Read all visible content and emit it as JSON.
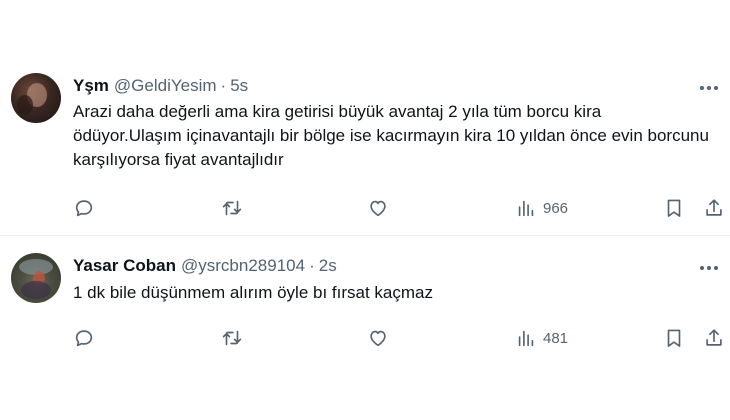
{
  "tweets": [
    {
      "name": "Yşm",
      "handle": "@GeldiYesim",
      "separator": "·",
      "time": "5s",
      "text": "Arazi daha değerli ama kira getirisi büyük avantaj 2 yıla tüm borcu kira ödüyor.Ulaşım içinavantajlı bir bölge ise kacırmayın kira 10 yıldan önce evin borcunu  karşılıyorsa fiyat avantajlıdır",
      "views": "966",
      "icons": [
        "more-icon",
        "reply-icon",
        "retweet-icon",
        "like-icon",
        "views-icon",
        "bookmark-icon",
        "share-icon"
      ]
    },
    {
      "name": "Yasar Coban",
      "handle": "@ysrcbn289104",
      "separator": "·",
      "time": "2s",
      "text": "1 dk bile düşünmem alırım öyle bı fırsat kaçmaz",
      "views": "481",
      "icons": [
        "more-icon",
        "reply-icon",
        "retweet-icon",
        "like-icon",
        "views-icon",
        "bookmark-icon",
        "share-icon"
      ]
    }
  ],
  "colors": {
    "text": "#0f1419",
    "secondary": "#536471",
    "divider": "#eff3f4",
    "background": "#ffffff"
  }
}
